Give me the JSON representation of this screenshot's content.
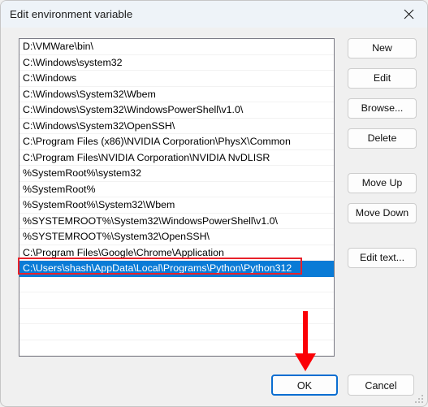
{
  "window": {
    "title": "Edit environment variable",
    "close_icon": "close-icon"
  },
  "listbox": {
    "items": [
      "D:\\VMWare\\bin\\",
      "C:\\Windows\\system32",
      "C:\\Windows",
      "C:\\Windows\\System32\\Wbem",
      "C:\\Windows\\System32\\WindowsPowerShell\\v1.0\\",
      "C:\\Windows\\System32\\OpenSSH\\",
      "C:\\Program Files (x86)\\NVIDIA Corporation\\PhysX\\Common",
      "C:\\Program Files\\NVIDIA Corporation\\NVIDIA NvDLISR",
      "%SystemRoot%\\system32",
      "%SystemRoot%",
      "%SystemRoot%\\System32\\Wbem",
      "%SYSTEMROOT%\\System32\\WindowsPowerShell\\v1.0\\",
      "%SYSTEMROOT%\\System32\\OpenSSH\\",
      "C:\\Program Files\\Google\\Chrome\\Application",
      "C:\\Users\\shash\\AppData\\Local\\Programs\\Python\\Python312"
    ],
    "selected_index": 14,
    "empty_rows": 5
  },
  "side_buttons": {
    "new": "New",
    "edit": "Edit",
    "browse": "Browse...",
    "delete": "Delete",
    "move_up": "Move Up",
    "move_down": "Move Down",
    "edit_text": "Edit text..."
  },
  "bottom_buttons": {
    "ok": "OK",
    "cancel": "Cancel"
  },
  "annotations": {
    "highlight_box_target": "C:\\Users\\shash\\AppData\\Local\\Programs\\Python\\Python312",
    "arrow_target": "OK",
    "color": "#e8212a"
  },
  "colors": {
    "selection": "#0a7bd6",
    "titlebar": "#eef3f8",
    "window_background": "#f0f0f0",
    "focus_ring": "#0a6ed1"
  }
}
